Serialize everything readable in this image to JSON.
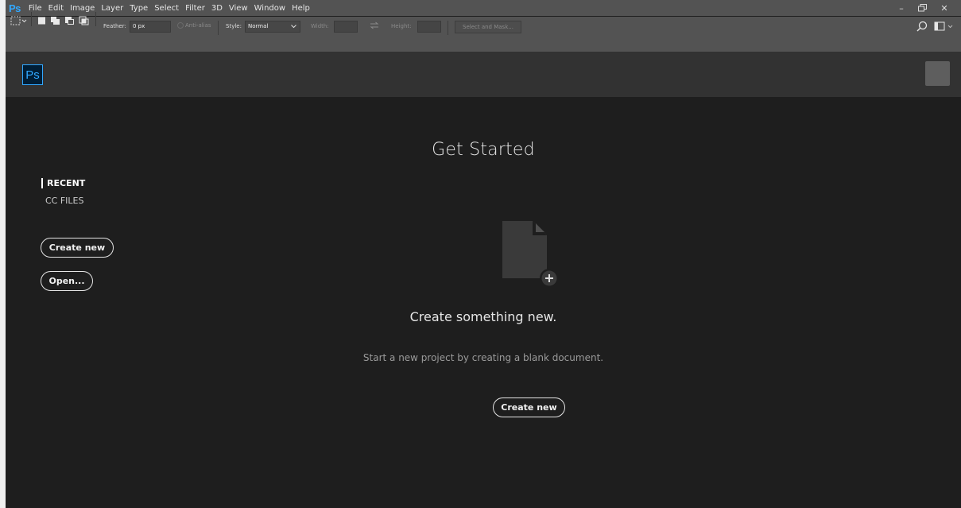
{
  "app": {
    "menu_logo": "Ps",
    "menu": [
      "File",
      "Edit",
      "Image",
      "Layer",
      "Type",
      "Select",
      "Filter",
      "3D",
      "View",
      "Window",
      "Help"
    ],
    "window_controls": {
      "minimize": "–",
      "restore": "🗗",
      "close": "✕"
    }
  },
  "options_bar": {
    "feather_label": "Feather:",
    "feather_value": "0 px",
    "anti_alias_label": "Anti-alias",
    "style_label": "Style:",
    "style_value": "Normal",
    "width_label": "Width:",
    "height_label": "Height:",
    "select_mask_label": "Select and Mask..."
  },
  "header": {
    "logo_text": "Ps"
  },
  "sidebar": {
    "items": [
      {
        "label": "RECENT",
        "active": true
      },
      {
        "label": "CC FILES",
        "active": false
      }
    ],
    "create_new_label": "Create new",
    "open_label": "Open..."
  },
  "main": {
    "title": "Get Started",
    "headline": "Create something new.",
    "subtext": "Start a new project by creating a blank document.",
    "create_new_label": "Create new"
  },
  "colors": {
    "accent": "#31a8ff",
    "background": "#1e1e1e",
    "header": "#323232",
    "toolbar": "#535353"
  }
}
